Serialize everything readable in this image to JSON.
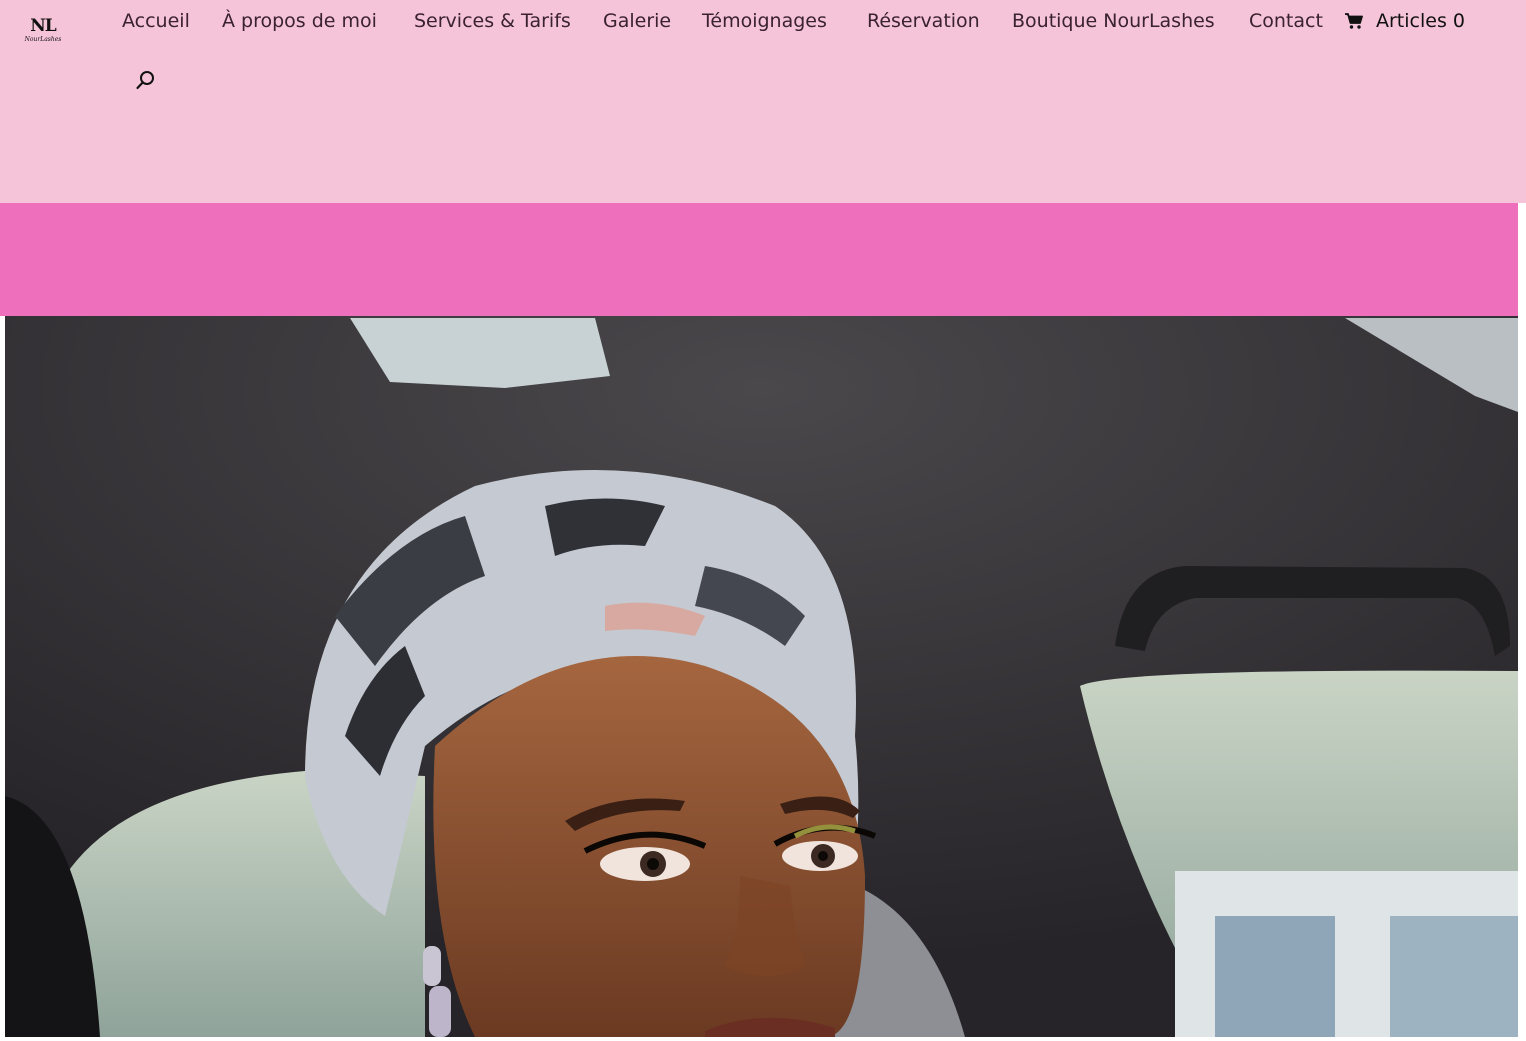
{
  "logo": {
    "monogram": "NL",
    "wordmark": "NourLashes"
  },
  "nav": {
    "items": [
      {
        "label": "Accueil"
      },
      {
        "label": "À propos de moi"
      },
      {
        "label": "Services & Tarifs"
      },
      {
        "label": "Galerie"
      },
      {
        "label": "Témoignages"
      },
      {
        "label": "Réservation"
      },
      {
        "label": "Boutique NourLashes"
      },
      {
        "label": "Contact"
      }
    ],
    "cart_label": "Articles 0",
    "cart_icon": "cart-icon",
    "search_icon": "search-icon"
  },
  "hero": {
    "image": "hero-photo"
  },
  "colors": {
    "header_bg": "#f6c4d9",
    "band_bg": "#ee6fbb",
    "nav_text": "#3a2230"
  }
}
